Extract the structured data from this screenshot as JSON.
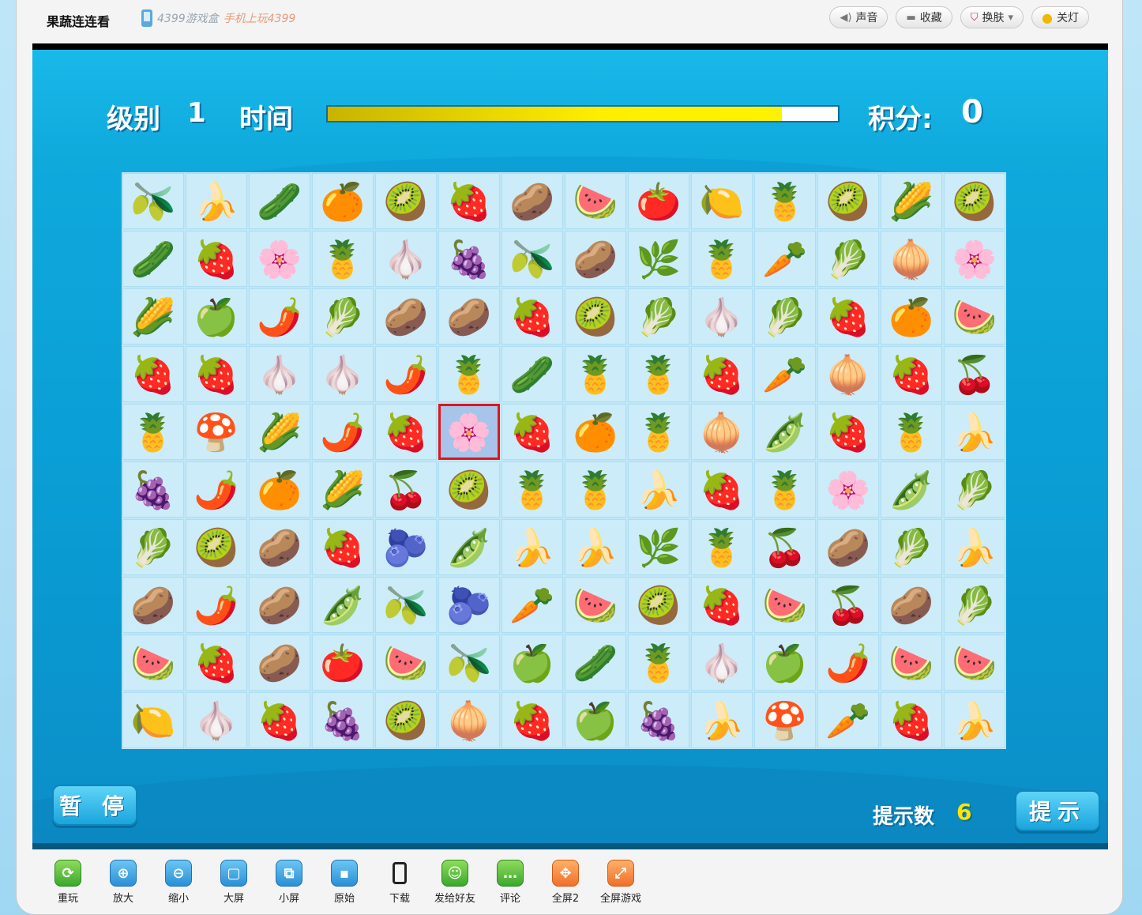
{
  "header": {
    "title": "果蔬连连看",
    "promo_box": "4399游戏盒",
    "promo_mobile": "手机上玩4399",
    "buttons": [
      {
        "label": "声音",
        "icon": "speaker-icon"
      },
      {
        "label": "收藏",
        "icon": "folder-icon"
      },
      {
        "label": "换肤",
        "icon": "shirt-icon"
      },
      {
        "label": "关灯",
        "icon": "bulb-icon"
      }
    ]
  },
  "hud": {
    "level_label": "级别",
    "level": "1",
    "time_label": "时间",
    "time_remaining_fraction": 0.89,
    "score_label": "积分:",
    "score": "0"
  },
  "board": {
    "selected": {
      "row": 4,
      "col": 5
    },
    "legend": {
      "O": "🫒",
      "B": "🍌",
      "C": "🥒",
      "R": "🍊",
      "K": "🥝",
      "S": "🍓",
      "W": "🥔",
      "M": "🍉",
      "T": "🍅",
      "L": "🍋",
      "P": "🍍",
      "N": "🌽",
      "D": "🌶️",
      "G": "🍇",
      "H": "🌸",
      "A": "🧄",
      "E": "🌿",
      "X": "🥕",
      "J": "🥬",
      "Q": "🧅",
      "F": "🍏",
      "Y": "🍒",
      "U": "🍄",
      "V": "🫛",
      "Z": "🫐"
    },
    "rows": [
      [
        "O",
        "B",
        "C",
        "R",
        "K",
        "S",
        "W",
        "M",
        "T",
        "L",
        "P",
        "K",
        "N",
        "K"
      ],
      [
        "C",
        "S",
        "H",
        "P",
        "A",
        "G",
        "O",
        "W",
        "E",
        "P",
        "X",
        "J",
        "Q",
        "H"
      ],
      [
        "N",
        "F",
        "D",
        "J",
        "W",
        "W",
        "S",
        "K",
        "J",
        "A",
        "J",
        "S",
        "R",
        "M"
      ],
      [
        "S",
        "S",
        "A",
        "A",
        "D",
        "P",
        "C",
        "P",
        "P",
        "S",
        "X",
        "Q",
        "S",
        "Y"
      ],
      [
        "P",
        "U",
        "N",
        "D",
        "S",
        "H",
        "S",
        "R",
        "P",
        "Q",
        "V",
        "S",
        "P",
        "B"
      ],
      [
        "G",
        "D",
        "R",
        "N",
        "Y",
        "K",
        "P",
        "P",
        "B",
        "S",
        "P",
        "H",
        "V",
        "J"
      ],
      [
        "J",
        "K",
        "W",
        "S",
        "Z",
        "V",
        "B",
        "B",
        "E",
        "P",
        "Y",
        "W",
        "J",
        "B"
      ],
      [
        "W",
        "D",
        "W",
        "V",
        "O",
        "Z",
        "X",
        "M",
        "K",
        "S",
        "M",
        "Y",
        "W",
        "J"
      ],
      [
        "M",
        "S",
        "W",
        "T",
        "M",
        "O",
        "F",
        "C",
        "P",
        "A",
        "F",
        "D",
        "M",
        "M"
      ],
      [
        "L",
        "A",
        "S",
        "G",
        "K",
        "Q",
        "S",
        "F",
        "G",
        "B",
        "U",
        "X",
        "S",
        "B"
      ]
    ]
  },
  "controls": {
    "pause": "暂 停",
    "hint": "提示",
    "hint_count_label": "提示数",
    "hint_count": "6"
  },
  "toolbar": [
    {
      "label": "重玩",
      "icon": "refresh-icon",
      "glyph": "⟳",
      "color": "green"
    },
    {
      "label": "放大",
      "icon": "zoom-in-icon",
      "glyph": "⊕",
      "color": "blue"
    },
    {
      "label": "缩小",
      "icon": "zoom-out-icon",
      "glyph": "⊖",
      "color": "blue"
    },
    {
      "label": "大屏",
      "icon": "large-screen-icon",
      "glyph": "▢",
      "color": "blue"
    },
    {
      "label": "小屏",
      "icon": "small-screen-icon",
      "glyph": "⧉",
      "color": "blue"
    },
    {
      "label": "原始",
      "icon": "original-size-icon",
      "glyph": "▪",
      "color": "blue"
    },
    {
      "label": "下载",
      "icon": "phone-icon",
      "glyph": "",
      "color": "plain"
    },
    {
      "label": "发给好友",
      "icon": "qq-icon",
      "glyph": "☺",
      "color": "green"
    },
    {
      "label": "评论",
      "icon": "comment-icon",
      "glyph": "…",
      "color": "green"
    },
    {
      "label": "全屏2",
      "icon": "fullscreen2-icon",
      "glyph": "✥",
      "color": "orange"
    },
    {
      "label": "全屏游戏",
      "icon": "fullscreen-game-icon",
      "glyph": "⤢",
      "color": "orange"
    }
  ]
}
